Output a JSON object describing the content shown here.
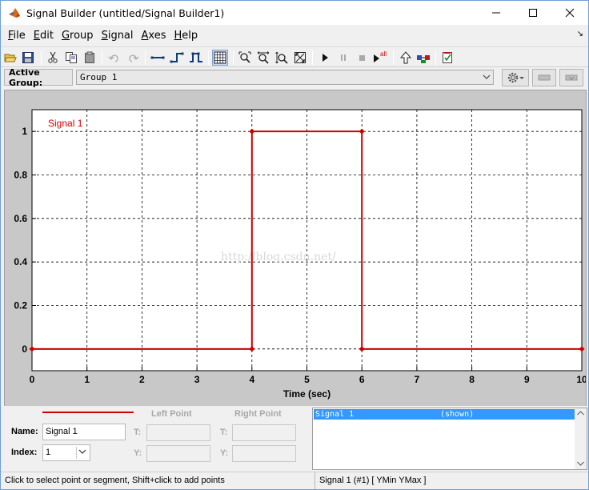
{
  "window": {
    "title": "Signal Builder (untitled/Signal Builder1)"
  },
  "menu": {
    "items": [
      "File",
      "Edit",
      "Group",
      "Signal",
      "Axes",
      "Help"
    ],
    "accelerators": [
      "F",
      "E",
      "G",
      "S",
      "A",
      "H"
    ],
    "right_glyph": "↘"
  },
  "toolbar": {
    "buttons": [
      "open-icon",
      "save-icon",
      "cut-icon",
      "copy-icon",
      "paste-icon",
      "undo-icon",
      "redo-icon",
      "line-segment-icon",
      "step-up-icon",
      "pulse-icon",
      "grid-toggle-icon",
      "zoom-x-y-icon",
      "zoom-x-icon",
      "zoom-y-icon",
      "full-view-icon",
      "start-simulation-icon",
      "pause-icon",
      "stop-icon",
      "run-all-icon",
      "move-up-icon",
      "model-icon",
      "verification-icon"
    ],
    "run_all_label": "all"
  },
  "group_bar": {
    "label": "Active Group:",
    "selected_group": "Group 1"
  },
  "chart_data": {
    "type": "line",
    "xlabel": "Time (sec)",
    "ylabel": "",
    "xlim": [
      0,
      10
    ],
    "ylim": [
      -0.1,
      1.1
    ],
    "x_ticks": [
      "0",
      "1",
      "2",
      "3",
      "4",
      "5",
      "6",
      "7",
      "8",
      "9",
      "10"
    ],
    "y_ticks": [
      "0",
      "0.2",
      "0.4",
      "0.6",
      "0.8",
      "1"
    ],
    "grid": true,
    "series": [
      {
        "name": "Signal 1",
        "color": "#cc0000",
        "x": [
          0,
          4,
          4,
          6,
          6,
          10
        ],
        "y": [
          0,
          0,
          1,
          1,
          0,
          0
        ]
      }
    ],
    "series_label": "Signal 1",
    "watermark": "http://blog.csdn.net/"
  },
  "signal_props": {
    "name_label": "Name:",
    "name_value": "Signal 1",
    "index_label": "Index:",
    "index_value": "1",
    "left_point_label": "Left Point",
    "right_point_label": "Right Point",
    "t_label": "T:",
    "y_label": "Y:"
  },
  "signal_list": {
    "rows": [
      {
        "name": "Signal 1",
        "state": "(shown)"
      }
    ]
  },
  "status": {
    "hint": "Click to select point or segment, Shift+click to add points",
    "selection": "Signal 1 (#1)  [ YMin YMax ]"
  },
  "colors": {
    "signal": "#cc0000",
    "selection": "#3399ff",
    "plot_bg": "#ffffff",
    "panel_bg": "#c8c8c8"
  }
}
